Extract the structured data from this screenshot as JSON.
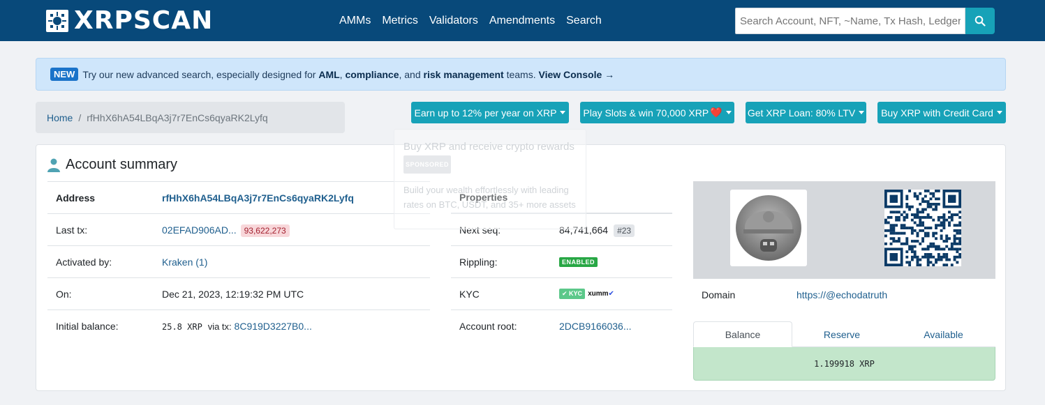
{
  "nav": {
    "brand": "XRPSCAN",
    "links": [
      "AMMs",
      "Metrics",
      "Validators",
      "Amendments",
      "Search"
    ],
    "search_placeholder": "Search Account, NFT, ~Name, Tx Hash, Ledger"
  },
  "alert": {
    "badge": "NEW",
    "text_1": "Try our new advanced search, especially designed for",
    "bold_1": "AML",
    "sep_1": ",",
    "bold_2": "compliance",
    "text_2": ", and",
    "bold_3": "risk management",
    "text_3": "teams.",
    "cta": "View Console →"
  },
  "breadcrumb": {
    "home": "Home",
    "separator": "/",
    "current": "rfHhX6hA54LBqA3j7r7EnCs6qyaRK2Lyfq"
  },
  "promos": [
    {
      "label": "Earn up to 12% per year on XRP"
    },
    {
      "label": "Play Slots & win 70,000 XRP",
      "emoji": "❤️"
    },
    {
      "label": "Get XRP Loan: 80% LTV"
    },
    {
      "label": "Buy XRP with Credit Card"
    }
  ],
  "sponsored": {
    "title": "Buy XRP and receive crypto rewards",
    "badge": "SPONSORED",
    "body": "Build your wealth effortlessly with leading rates on BTC, USDT, and 35+ more assets"
  },
  "account": {
    "title": "Account summary",
    "left_rows": {
      "address": {
        "label": "Address",
        "value": "rfHhX6hA54LBqA3j7r7EnCs6qyaRK2Lyfq"
      },
      "last_tx": {
        "label": "Last tx:",
        "value": "02EFAD906AD...",
        "ledger": "93,622,273"
      },
      "activated": {
        "label": "Activated by:",
        "value": "Kraken (1)"
      },
      "on": {
        "label": "On:",
        "value": "Dec 21, 2023, 12:19:32 PM UTC"
      },
      "initial": {
        "label": "Initial balance:",
        "amount": "25.8 XRP",
        "via": "via tx:",
        "tx": "8C919D3227B0..."
      }
    },
    "right_rows": {
      "header": "Properties",
      "next_seq": {
        "label": "Next seq:",
        "value": "84,741,664",
        "badge": "#23"
      },
      "rippling": {
        "label": "Rippling:",
        "value": "ENABLED"
      },
      "kyc": {
        "label": "KYC",
        "kyc_badge": "KYC",
        "provider": "xumm",
        "check": "✔"
      },
      "root": {
        "label": "Account root:",
        "value": "2DCB9166036..."
      }
    },
    "domain": {
      "label": "Domain",
      "value": "https://@echodatruth"
    },
    "balance_tabs": [
      "Balance",
      "Reserve",
      "Available"
    ],
    "balance_value": "1.199918 XRP"
  },
  "colors": {
    "navbar": "#08497a",
    "accent": "#17a2b8",
    "link": "#1f5f8e",
    "balance_bg": "#c3e6cb"
  }
}
